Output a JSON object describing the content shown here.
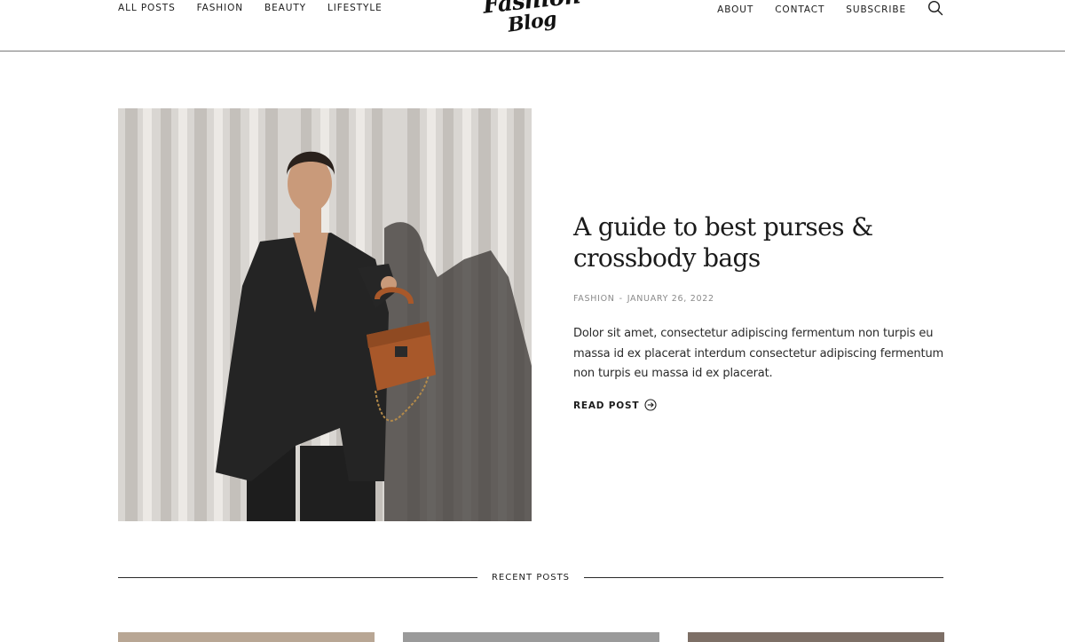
{
  "nav": {
    "left": [
      "ALL POSTS",
      "FASHION",
      "BEAUTY",
      "LIFESTYLE"
    ],
    "right": [
      "ABOUT",
      "CONTACT",
      "SUBSCRIBE"
    ]
  },
  "logo": {
    "line1": "Fashion",
    "line2": "Blog"
  },
  "featured": {
    "title": "A guide to best purses & crossbody bags",
    "category": "FASHION",
    "separator": "-",
    "date": "JANUARY 26, 2022",
    "excerpt": "Dolor sit amet, consectetur adipiscing fermentum non turpis eu massa id ex placerat interdum consectetur adipiscing fermentum non turpis eu massa id ex placerat.",
    "cta": "READ POST"
  },
  "recent": {
    "label": "RECENT POSTS"
  },
  "colors": {
    "text": "#1c1c1c",
    "meta": "#8a8a8a",
    "divider": "#7a7a7a",
    "bag": "#a8582a"
  },
  "icons": {
    "search": "search-icon",
    "read_arrow": "arrow-circle-right-icon"
  }
}
